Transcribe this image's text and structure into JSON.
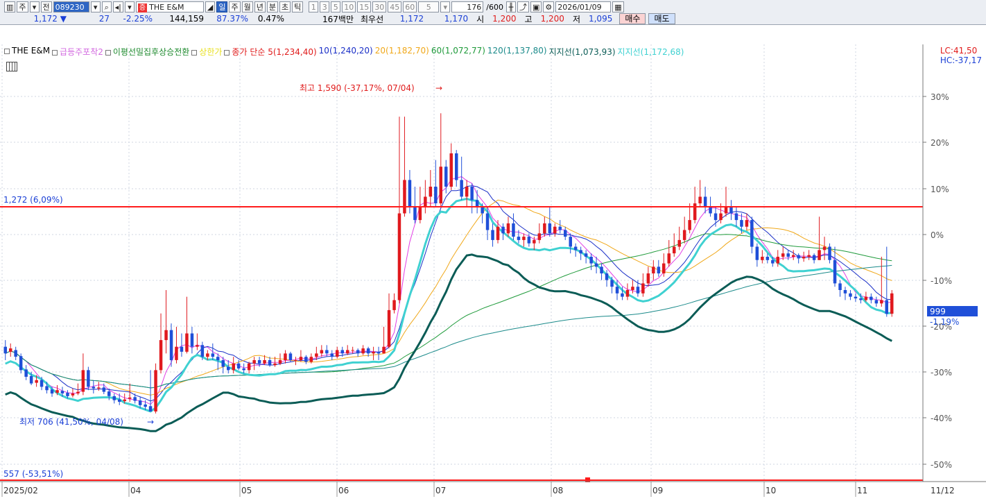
{
  "toolbar": {
    "jong_label": "주",
    "jeon_label": "전",
    "code": "089230",
    "market_badge": "증",
    "stock_name": "THE E&M",
    "periods": [
      "일",
      "주",
      "월",
      "년",
      "분",
      "초",
      "틱"
    ],
    "active_period": "일",
    "intervals": [
      "1",
      "3",
      "5",
      "10",
      "15",
      "30",
      "45",
      "60"
    ],
    "custom_interval": "5",
    "count": "176",
    "count_max": "/600",
    "date": "2026/01/09"
  },
  "quote": {
    "price": "1,172",
    "change": "27",
    "change_pct": "-2.25%",
    "volume": "144,159",
    "vol_ratio": "87.37%",
    "turnover_pct": "0.47%",
    "amount": "167백만",
    "best_ask_label": "최우선",
    "best_ask": "1,172",
    "best_bid": "1,170",
    "open_label": "시",
    "open": "1,200",
    "high_label": "고",
    "high": "1,200",
    "low_label": "저",
    "low": "1,095",
    "buy_label": "매수",
    "sell_label": "매도"
  },
  "legend": {
    "name": "THE E&M",
    "ind1": "급등주포착2",
    "ind2": "이평선밀집후상승전환",
    "ind3": "상한가",
    "ind4": "종가 단순",
    "ma5": "5(1,234,40)",
    "ma10": "10(1,240,20)",
    "ma20": "20(1,182,70)",
    "ma60": "60(1,072,77)",
    "ma120": "120(1,137,80)",
    "support1": "지지선(1,073,93)",
    "support2": "지지선(1,172,68)"
  },
  "lc_label": "LC:41,50",
  "hc_label": "HC:-37,17",
  "colors": {
    "up": "#e0191e",
    "down": "#1f4fd8",
    "ma5": "#e23ee5",
    "ma10": "#1a2fc7",
    "ma20": "#f0a81a",
    "ma60": "#1e9a3a",
    "ma120": "#1a8a8a",
    "support1": "#0b5c56",
    "support2": "#3fd1d1",
    "hline": "#ff1b1b"
  },
  "chart_data": {
    "type": "candlestick",
    "price_axis_pct_ticks": [
      "30%",
      "20%",
      "10%",
      "0%",
      "-10%",
      "-20%",
      "-30%",
      "-40%",
      "-50%"
    ],
    "date_ticks": [
      "2025/02",
      "04",
      "05",
      "06",
      "07",
      "08",
      "09",
      "10",
      "11",
      "11/12"
    ],
    "current_price_label": "999",
    "current_pct_label": "-1.19%",
    "hline_upper": "1,272 (6,09%)",
    "hline_lower": "557 (-53,51%)",
    "max_annotation": "최고 1,590 (-37,17%, 07/04)",
    "min_annotation": "최저 706 (41,50%, 04/08)",
    "price_range": [
      500,
      1740
    ],
    "candles": [
      [
        900,
        880,
        920,
        860
      ],
      [
        885,
        895,
        910,
        870
      ],
      [
        890,
        870,
        900,
        860
      ],
      [
        872,
        830,
        880,
        820
      ],
      [
        832,
        810,
        845,
        800
      ],
      [
        812,
        790,
        825,
        785
      ],
      [
        792,
        800,
        815,
        780
      ],
      [
        800,
        780,
        810,
        770
      ],
      [
        782,
        770,
        795,
        760
      ],
      [
        772,
        760,
        780,
        750
      ],
      [
        762,
        770,
        785,
        755
      ],
      [
        768,
        760,
        780,
        750
      ],
      [
        762,
        752,
        770,
        745
      ],
      [
        754,
        760,
        775,
        748
      ],
      [
        760,
        765,
        790,
        755
      ],
      [
        765,
        830,
        880,
        755
      ],
      [
        830,
        780,
        840,
        770
      ],
      [
        780,
        775,
        800,
        760
      ],
      [
        775,
        778,
        795,
        768
      ],
      [
        778,
        765,
        790,
        758
      ],
      [
        766,
        752,
        775,
        740
      ],
      [
        752,
        740,
        760,
        730
      ],
      [
        742,
        735,
        760,
        725
      ],
      [
        737,
        742,
        760,
        730
      ],
      [
        744,
        748,
        790,
        735
      ],
      [
        749,
        738,
        760,
        730
      ],
      [
        739,
        725,
        750,
        715
      ],
      [
        727,
        720,
        740,
        710
      ],
      [
        722,
        706,
        830,
        706
      ],
      [
        706,
        830,
        850,
        700
      ],
      [
        830,
        920,
        1000,
        820
      ],
      [
        920,
        950,
        1070,
        880
      ],
      [
        950,
        860,
        970,
        840
      ],
      [
        860,
        900,
        960,
        850
      ],
      [
        900,
        885,
        940,
        870
      ],
      [
        885,
        940,
        1050,
        880
      ],
      [
        940,
        900,
        960,
        880
      ],
      [
        900,
        905,
        940,
        890
      ],
      [
        905,
        870,
        915,
        860
      ],
      [
        870,
        880,
        890,
        860
      ],
      [
        880,
        870,
        910,
        860
      ],
      [
        870,
        860,
        880,
        830
      ],
      [
        860,
        840,
        870,
        820
      ],
      [
        840,
        830,
        860,
        820
      ],
      [
        830,
        850,
        870,
        820
      ],
      [
        850,
        835,
        860,
        830
      ],
      [
        835,
        830,
        850,
        820
      ],
      [
        830,
        850,
        855,
        820
      ],
      [
        850,
        860,
        870,
        830
      ],
      [
        860,
        850,
        870,
        840
      ],
      [
        850,
        860,
        875,
        845
      ],
      [
        860,
        845,
        870,
        840
      ],
      [
        845,
        850,
        870,
        840
      ],
      [
        850,
        860,
        880,
        845
      ],
      [
        860,
        880,
        890,
        850
      ],
      [
        880,
        860,
        885,
        855
      ],
      [
        860,
        860,
        870,
        845
      ],
      [
        860,
        870,
        890,
        855
      ],
      [
        870,
        855,
        875,
        848
      ],
      [
        855,
        870,
        880,
        850
      ],
      [
        870,
        880,
        900,
        860
      ],
      [
        880,
        890,
        905,
        870
      ],
      [
        890,
        880,
        905,
        870
      ],
      [
        880,
        870,
        890,
        860
      ],
      [
        870,
        890,
        900,
        865
      ],
      [
        890,
        880,
        900,
        870
      ],
      [
        880,
        890,
        905,
        875
      ],
      [
        890,
        890,
        900,
        880
      ],
      [
        890,
        880,
        895,
        870
      ],
      [
        880,
        895,
        905,
        875
      ],
      [
        895,
        880,
        900,
        870
      ],
      [
        880,
        885,
        900,
        860
      ],
      [
        885,
        880,
        900,
        860
      ],
      [
        880,
        900,
        960,
        880
      ],
      [
        900,
        1010,
        1060,
        895
      ],
      [
        1010,
        1040,
        1060,
        1000
      ],
      [
        1040,
        1300,
        1590,
        1030
      ],
      [
        1300,
        1400,
        1590,
        1290
      ],
      [
        1400,
        1320,
        1430,
        1300
      ],
      [
        1320,
        1280,
        1380,
        1270
      ],
      [
        1280,
        1320,
        1380,
        1270
      ],
      [
        1320,
        1350,
        1400,
        1300
      ],
      [
        1350,
        1380,
        1430,
        1320
      ],
      [
        1380,
        1330,
        1460,
        1320
      ],
      [
        1330,
        1440,
        1600,
        1320
      ],
      [
        1440,
        1380,
        1460,
        1360
      ],
      [
        1380,
        1480,
        1510,
        1370
      ],
      [
        1480,
        1400,
        1490,
        1380
      ],
      [
        1400,
        1350,
        1470,
        1340
      ],
      [
        1350,
        1380,
        1400,
        1320
      ],
      [
        1380,
        1340,
        1390,
        1300
      ],
      [
        1340,
        1320,
        1370,
        1300
      ],
      [
        1320,
        1300,
        1330,
        1270
      ],
      [
        1300,
        1250,
        1320,
        1220
      ],
      [
        1250,
        1220,
        1270,
        1200
      ],
      [
        1220,
        1260,
        1280,
        1210
      ],
      [
        1260,
        1240,
        1270,
        1220
      ],
      [
        1240,
        1270,
        1290,
        1230
      ],
      [
        1270,
        1230,
        1300,
        1220
      ],
      [
        1230,
        1220,
        1250,
        1210
      ],
      [
        1220,
        1230,
        1240,
        1200
      ],
      [
        1230,
        1210,
        1240,
        1200
      ],
      [
        1210,
        1220,
        1230,
        1190
      ],
      [
        1220,
        1240,
        1270,
        1210
      ],
      [
        1240,
        1270,
        1290,
        1230
      ],
      [
        1270,
        1240,
        1320,
        1230
      ],
      [
        1240,
        1260,
        1270,
        1230
      ],
      [
        1260,
        1250,
        1280,
        1240
      ],
      [
        1250,
        1230,
        1260,
        1220
      ],
      [
        1230,
        1200,
        1240,
        1180
      ],
      [
        1200,
        1190,
        1210,
        1170
      ],
      [
        1190,
        1180,
        1200,
        1160
      ],
      [
        1180,
        1170,
        1190,
        1150
      ],
      [
        1170,
        1150,
        1180,
        1130
      ],
      [
        1150,
        1140,
        1170,
        1120
      ],
      [
        1140,
        1120,
        1150,
        1100
      ],
      [
        1120,
        1100,
        1130,
        1080
      ],
      [
        1100,
        1080,
        1110,
        1060
      ],
      [
        1080,
        1060,
        1100,
        1040
      ],
      [
        1060,
        1050,
        1080,
        1040
      ],
      [
        1050,
        1070,
        1090,
        1040
      ],
      [
        1070,
        1080,
        1100,
        1060
      ],
      [
        1080,
        1060,
        1100,
        1050
      ],
      [
        1060,
        1090,
        1120,
        1050
      ],
      [
        1090,
        1120,
        1140,
        1080
      ],
      [
        1120,
        1140,
        1160,
        1100
      ],
      [
        1140,
        1120,
        1160,
        1110
      ],
      [
        1120,
        1150,
        1180,
        1110
      ],
      [
        1150,
        1180,
        1220,
        1140
      ],
      [
        1180,
        1200,
        1240,
        1170
      ],
      [
        1200,
        1220,
        1260,
        1190
      ],
      [
        1220,
        1250,
        1290,
        1210
      ],
      [
        1250,
        1280,
        1330,
        1240
      ],
      [
        1280,
        1330,
        1380,
        1270
      ],
      [
        1330,
        1350,
        1400,
        1320
      ],
      [
        1350,
        1320,
        1380,
        1300
      ],
      [
        1320,
        1300,
        1350,
        1290
      ],
      [
        1300,
        1280,
        1320,
        1260
      ],
      [
        1280,
        1300,
        1330,
        1270
      ],
      [
        1300,
        1320,
        1380,
        1290
      ],
      [
        1320,
        1300,
        1340,
        1280
      ],
      [
        1300,
        1280,
        1320,
        1260
      ],
      [
        1280,
        1260,
        1300,
        1240
      ],
      [
        1260,
        1280,
        1300,
        1250
      ],
      [
        1280,
        1200,
        1290,
        1180
      ],
      [
        1200,
        1160,
        1210,
        1140
      ],
      [
        1160,
        1170,
        1190,
        1150
      ],
      [
        1170,
        1160,
        1180,
        1150
      ],
      [
        1160,
        1150,
        1170,
        1140
      ],
      [
        1150,
        1170,
        1190,
        1140
      ],
      [
        1170,
        1180,
        1200,
        1160
      ],
      [
        1180,
        1170,
        1190,
        1160
      ],
      [
        1170,
        1175,
        1190,
        1160
      ],
      [
        1175,
        1165,
        1180,
        1150
      ],
      [
        1165,
        1170,
        1185,
        1155
      ],
      [
        1170,
        1175,
        1190,
        1160
      ],
      [
        1175,
        1160,
        1180,
        1150
      ],
      [
        1160,
        1190,
        1290,
        1160
      ],
      [
        1190,
        1200,
        1230,
        1160
      ],
      [
        1200,
        1160,
        1210,
        1150
      ],
      [
        1160,
        1090,
        1200,
        1080
      ],
      [
        1090,
        1070,
        1100,
        1050
      ],
      [
        1070,
        1060,
        1080,
        1040
      ],
      [
        1060,
        1050,
        1070,
        1040
      ],
      [
        1050,
        1045,
        1060,
        1035
      ],
      [
        1045,
        1040,
        1060,
        1030
      ],
      [
        1040,
        1050,
        1065,
        1035
      ],
      [
        1050,
        1040,
        1060,
        1030
      ],
      [
        1040,
        1030,
        1050,
        1020
      ],
      [
        1030,
        1040,
        1170,
        1020
      ],
      [
        1040,
        999,
        1200,
        990
      ],
      [
        999,
        1060,
        1070,
        990
      ]
    ]
  }
}
